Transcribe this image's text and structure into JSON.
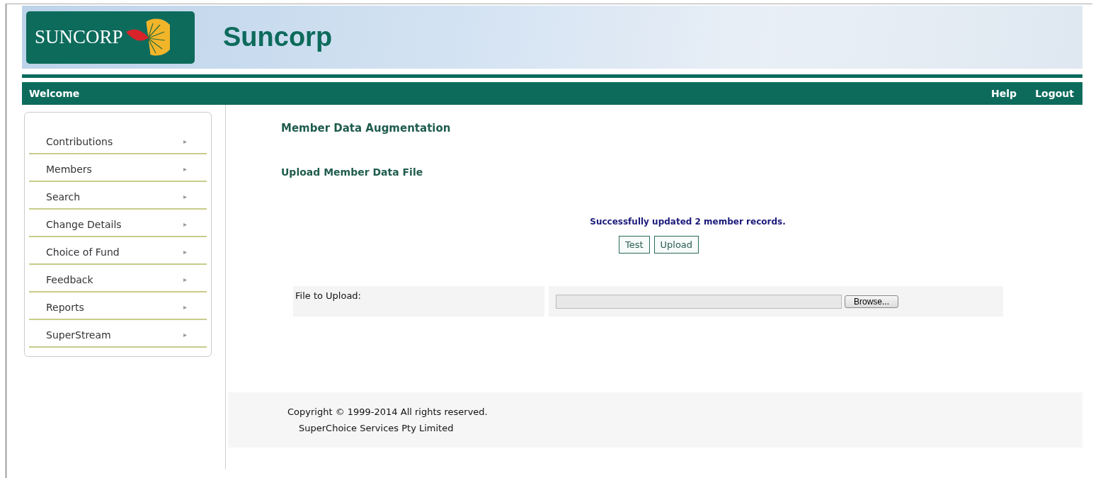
{
  "header": {
    "logo_text": "SUNCORP",
    "title": "Suncorp"
  },
  "nav": {
    "welcome": "Welcome",
    "links": [
      "Help",
      "Logout"
    ]
  },
  "sidebar": {
    "items": [
      {
        "label": "Contributions",
        "arrow": "▸"
      },
      {
        "label": "Members",
        "arrow": "▸"
      },
      {
        "label": "Search",
        "arrow": "▸"
      },
      {
        "label": "Change Details",
        "arrow": "▸"
      },
      {
        "label": "Choice of Fund",
        "arrow": "▸"
      },
      {
        "label": "Feedback",
        "arrow": "▸"
      },
      {
        "label": "Reports",
        "arrow": "▸"
      },
      {
        "label": "SuperStream",
        "arrow": "▸"
      }
    ]
  },
  "content": {
    "title": "Member Data Augmentation",
    "subtitle": "Upload Member Data File",
    "message": "Successfully updated 2 member records.",
    "buttons": [
      "Test",
      "Upload"
    ],
    "file_row": {
      "label": "File to Upload:",
      "browse": "Browse..."
    }
  },
  "footer": {
    "copyright": "Copyright © 1999-2014 All rights reserved.",
    "company": "SuperChoice Services Pty Limited"
  }
}
